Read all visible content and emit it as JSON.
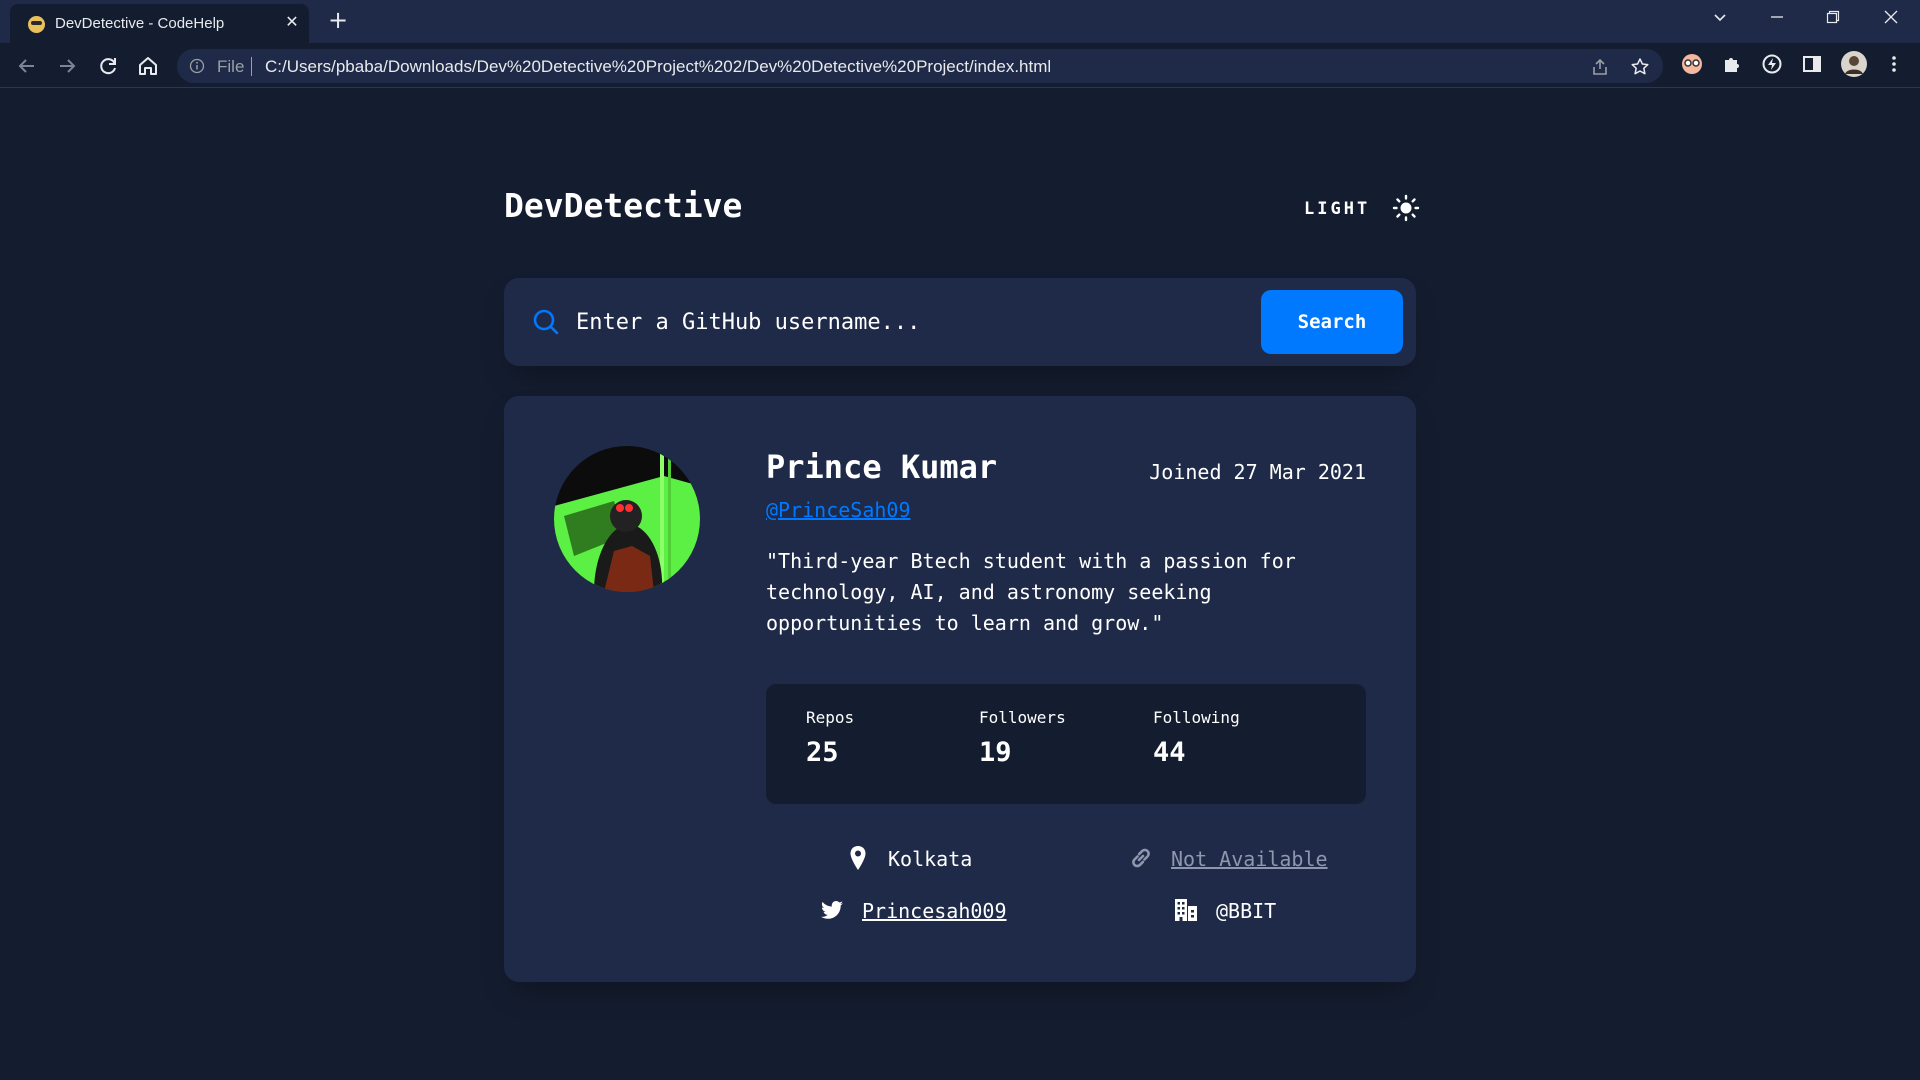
{
  "browser": {
    "tab_title": "DevDetective - CodeHelp",
    "url_scheme_label": "File",
    "url": "C:/Users/pbaba/Downloads/Dev%20Detective%20Project%202/Dev%20Detective%20Project/index.html"
  },
  "app": {
    "title": "DevDetective",
    "theme_toggle_label": "LIGHT",
    "accent_color": "#0079ff",
    "background_color": "#141d2f",
    "card_color": "#1e2a47"
  },
  "search": {
    "placeholder": "Enter a GitHub username...",
    "value": "",
    "button_label": "Search"
  },
  "profile": {
    "name": "Prince Kumar",
    "joined": "Joined 27 Mar 2021",
    "handle": "@PrinceSah09",
    "bio": "\"Third-year Btech student with a passion for technology, AI, and astronomy seeking opportunities to learn and grow.\"",
    "stats": [
      {
        "label": "Repos",
        "value": "25"
      },
      {
        "label": "Followers",
        "value": "19"
      },
      {
        "label": "Following",
        "value": "44"
      }
    ],
    "location": "Kolkata",
    "website": "Not Available",
    "twitter": "Princesah009",
    "company": "@BBIT"
  }
}
